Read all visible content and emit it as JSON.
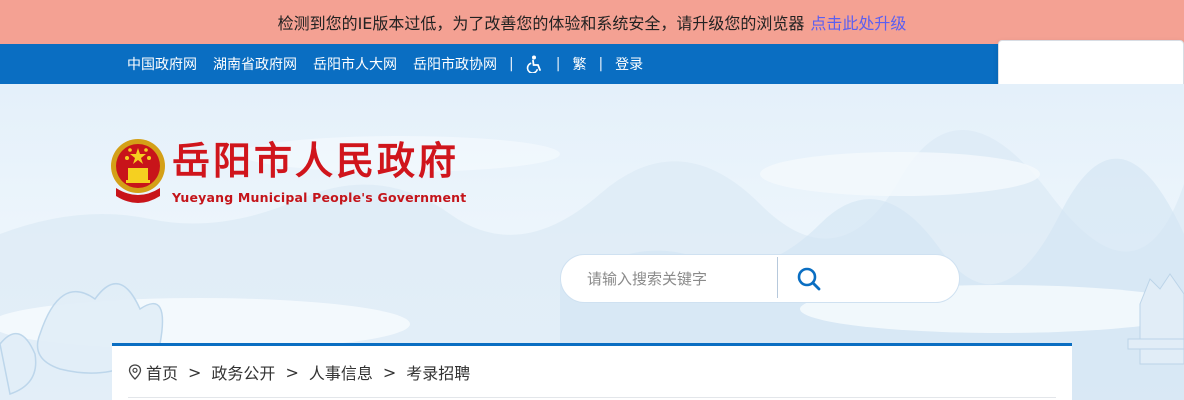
{
  "ie_warning": {
    "message": "检测到您的IE版本过低，为了改善您的体验和系统安全，请升级您的浏览器",
    "upgrade_link": "点击此处升级"
  },
  "topnav": {
    "links": [
      "中国政府网",
      "湖南省政府网",
      "岳阳市人大网",
      "岳阳市政协网"
    ],
    "accessibility_icon": "wheelchair-icon",
    "traditional": "繁",
    "login": "登录",
    "separator": "|"
  },
  "header": {
    "title": "岳阳市人民政府",
    "subtitle": "Yueyang Municipal People's Government",
    "emblem_icon": "national-emblem-icon"
  },
  "search": {
    "placeholder": "请输入搜索关键字",
    "button_icon": "search-icon"
  },
  "breadcrumb": {
    "location_icon": "location-pin-icon",
    "items": [
      "首页",
      "政务公开",
      "人事信息",
      "考录招聘"
    ],
    "separator": ">"
  },
  "colors": {
    "warning_bg": "#f4a193",
    "nav_bg": "#0a6ec2",
    "title_red": "#d0151c",
    "link_purple": "#5b5ff0"
  }
}
